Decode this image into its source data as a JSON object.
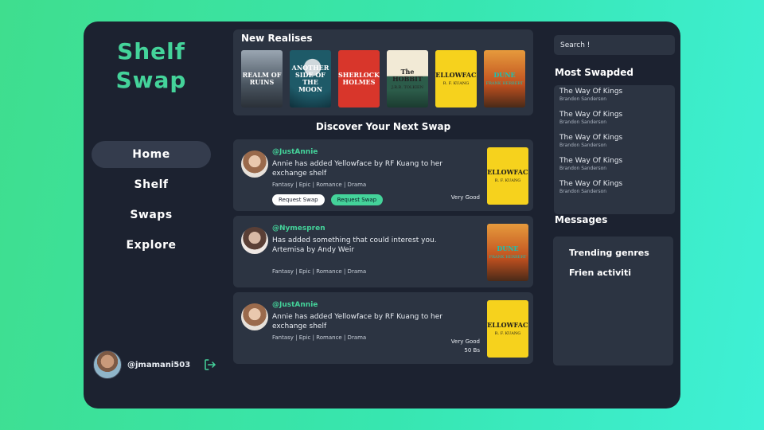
{
  "sidebar": {
    "logo_line1": "Shelf",
    "logo_line2": "Swap",
    "nav": [
      "Home",
      "Shelf",
      "Swaps",
      "Explore"
    ],
    "active": "Home",
    "username": "@jmamani503"
  },
  "releases": {
    "title": "New Realises",
    "books": [
      {
        "title": "REALM OF RUINS",
        "author": ""
      },
      {
        "title": "ANOTHER SIDE OF THE MOON",
        "author": ""
      },
      {
        "title": "SHERLOCK HOLMES",
        "author": ""
      },
      {
        "title": "The HOBBIT",
        "author": "J.R.R. TOLKIEN"
      },
      {
        "title": "YELLOWFACE",
        "author": "R. F. KUANG"
      },
      {
        "title": "DUNE",
        "author": "FRANK HERBERT"
      }
    ]
  },
  "discover": {
    "title": "Discover Your Next Swap",
    "cards": [
      {
        "user": "@JustAnnie",
        "text": "Annie has added Yellowface by RF Kuang to her exchange shelf",
        "tags": "Fantasy | Epic | Romance | Drama",
        "btn1": "Request Swap",
        "btn2": "Request Swap",
        "condition": "Very Good",
        "cover": {
          "title": "YELLOWFACE",
          "author": "R. F. KUANG"
        }
      },
      {
        "user": "@Nymespren",
        "text": "Has added something that could interest you. Artemisa by Andy Weir",
        "tags": "Fantasy | Epic | Romance | Drama",
        "cover": {
          "title": "DUNE",
          "author": "FRANK HERBERT"
        }
      },
      {
        "user": "@JustAnnie",
        "text": "Annie has added Yellowface by RF Kuang to her exchange shelf",
        "tags": "Fantasy | Epic | Romance | Drama",
        "condition": "Very Good",
        "price": "50 Bs",
        "cover": {
          "title": "YELLOWFACE",
          "author": "R. F. KUANG"
        }
      }
    ]
  },
  "search": {
    "placeholder": "Search !"
  },
  "most_swapped": {
    "title": "Most Swapded",
    "items": [
      {
        "title": "The Way Of Kings",
        "author": "Brandon Sanderson"
      },
      {
        "title": "The Way Of Kings",
        "author": "Brandon Sanderson"
      },
      {
        "title": "The Way Of Kings",
        "author": "Brandon Sanderson"
      },
      {
        "title": "The Way Of Kings",
        "author": "Brandon Sanderson"
      },
      {
        "title": "The Way Of Kings",
        "author": "Brandon Sanderson"
      }
    ]
  },
  "messages": {
    "title": "Messages",
    "items": [
      "Trending genres",
      "Frien activiti"
    ]
  },
  "colors": {
    "accent": "#44d39a",
    "panel": "#2c3442",
    "app_bg": "#1c2230"
  }
}
